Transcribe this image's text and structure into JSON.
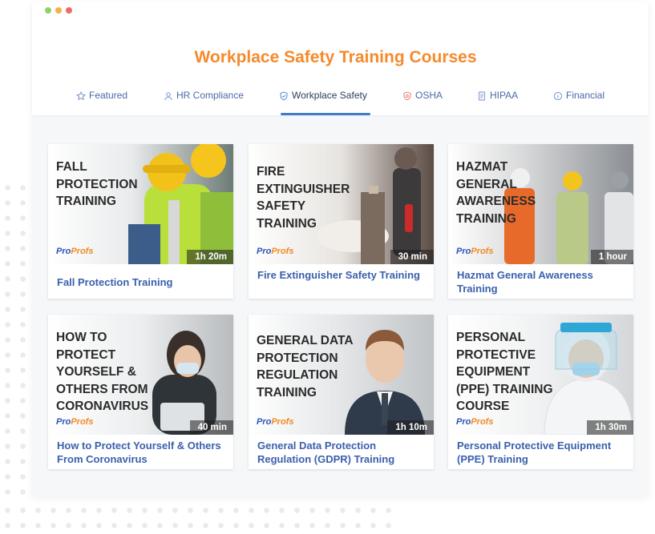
{
  "colors": {
    "accent_orange": "#f58a2c",
    "link_blue": "#3a60ad",
    "tab_underline": "#3d7dca",
    "window_dots": [
      "#8fd16a",
      "#f4b24a",
      "#f06a6a"
    ]
  },
  "header": {
    "title": "Workplace Safety Training Courses"
  },
  "tabs": [
    {
      "label": "Featured",
      "icon": "star-icon",
      "active": false
    },
    {
      "label": "HR Compliance",
      "icon": "user-icon",
      "active": false
    },
    {
      "label": "Workplace Safety",
      "icon": "shield-icon",
      "active": true
    },
    {
      "label": "OSHA",
      "icon": "shield-icon",
      "active": false
    },
    {
      "label": "HIPAA",
      "icon": "document-icon",
      "active": false
    },
    {
      "label": "Financial",
      "icon": "info-icon",
      "active": false
    }
  ],
  "brand": {
    "logo_text": "Pro",
    "logo_accent": "Profs"
  },
  "courses": [
    {
      "thumb_title": "Fall Protection Training",
      "duration": "1h 20m",
      "label": "Fall Protection Training"
    },
    {
      "thumb_title": "Fire Extinguisher Safety Training",
      "duration": "30 min",
      "label": "Fire Extinguisher Safety Training"
    },
    {
      "thumb_title": "Hazmat General Awareness Training",
      "duration": "1 hour",
      "label": "Hazmat General Awareness Training"
    },
    {
      "thumb_title": "How to Protect Yourself & Others From Coronavirus",
      "duration": "40 min",
      "label": "How to Protect Yourself & Others From Coronavirus"
    },
    {
      "thumb_title": "General Data Protection Regulation Training",
      "duration": "1h 10m",
      "label": "General Data Protection Regulation (GDPR) Training"
    },
    {
      "thumb_title": "Personal Protective Equipment (PPE) Training Course",
      "duration": "1h 30m",
      "label": "Personal Protective Equipment (PPE) Training"
    }
  ]
}
